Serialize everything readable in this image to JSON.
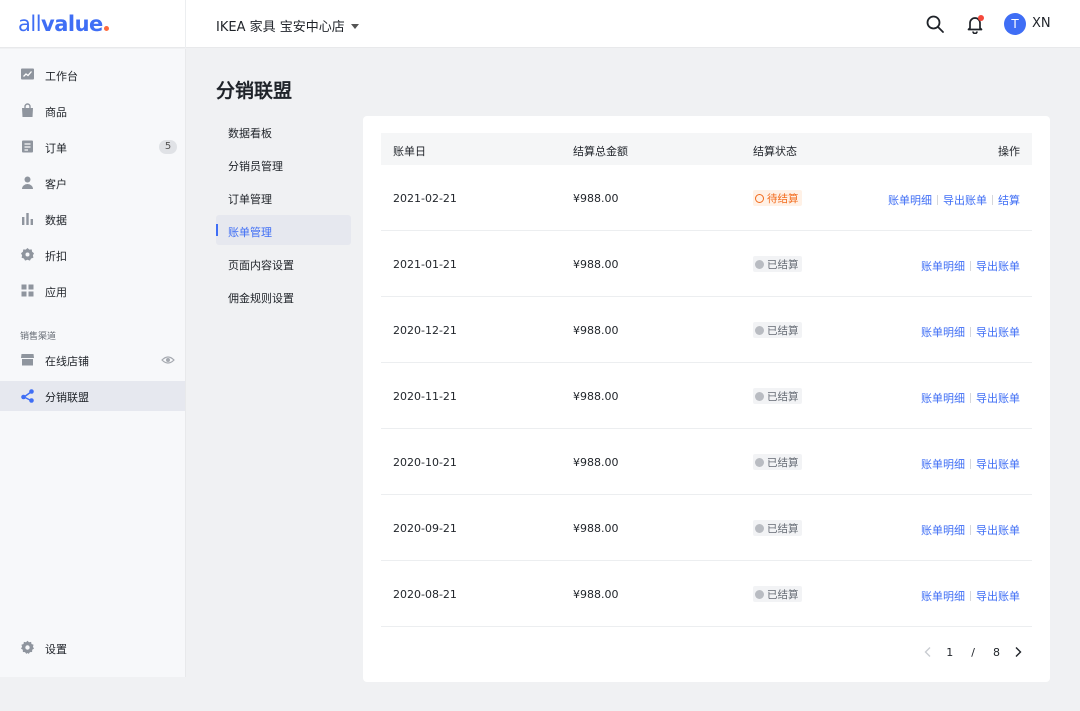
{
  "topbar": {
    "logo_left": "all",
    "logo_right": "value",
    "store_name": "IKEA 家具 宝安中心店",
    "user_initial": "T",
    "user_name": "XN"
  },
  "sidebar": {
    "items": [
      {
        "label": "工作台",
        "icon": "dashboard-icon"
      },
      {
        "label": "商品",
        "icon": "bag-icon"
      },
      {
        "label": "订单",
        "icon": "order-icon",
        "badge": "5"
      },
      {
        "label": "客户",
        "icon": "user-icon"
      },
      {
        "label": "数据",
        "icon": "chart-icon"
      },
      {
        "label": "折扣",
        "icon": "discount-icon"
      },
      {
        "label": "应用",
        "icon": "apps-icon"
      }
    ],
    "section_label": "销售渠道",
    "channels": [
      {
        "label": "在线店铺",
        "icon": "store-icon"
      },
      {
        "label": "分销联盟",
        "icon": "share-icon",
        "active": true
      }
    ],
    "settings_label": "设置"
  },
  "page": {
    "title": "分销联盟",
    "subnav": [
      "数据看板",
      "分销员管理",
      "订单管理",
      "账单管理",
      "页面内容设置",
      "佣金规则设置"
    ],
    "subnav_active": "账单管理"
  },
  "table": {
    "columns": [
      "账单日",
      "结算总金额",
      "结算状态",
      "操作"
    ],
    "rows": [
      {
        "date": "2021-02-21",
        "amount": "¥988.00",
        "status": "待结算",
        "state": "pending",
        "actions": [
          "账单明细",
          "导出账单",
          "结算"
        ]
      },
      {
        "date": "2021-01-21",
        "amount": "¥988.00",
        "status": "已结算",
        "state": "done",
        "actions": [
          "账单明细",
          "导出账单"
        ]
      },
      {
        "date": "2020-12-21",
        "amount": "¥988.00",
        "status": "已结算",
        "state": "done",
        "actions": [
          "账单明细",
          "导出账单"
        ]
      },
      {
        "date": "2020-11-21",
        "amount": "¥988.00",
        "status": "已结算",
        "state": "done",
        "actions": [
          "账单明细",
          "导出账单"
        ]
      },
      {
        "date": "2020-10-21",
        "amount": "¥988.00",
        "status": "已结算",
        "state": "done",
        "actions": [
          "账单明细",
          "导出账单"
        ]
      },
      {
        "date": "2020-09-21",
        "amount": "¥988.00",
        "status": "已结算",
        "state": "done",
        "actions": [
          "账单明细",
          "导出账单"
        ]
      },
      {
        "date": "2020-08-21",
        "amount": "¥988.00",
        "status": "已结算",
        "state": "done",
        "actions": [
          "账单明细",
          "导出账单"
        ]
      }
    ]
  },
  "pagination": {
    "current": "1",
    "separator": "/",
    "total": "8"
  },
  "colors": {
    "accent": "#3f6ef5",
    "pending": "#f26a1b",
    "notify": "#f5483b"
  }
}
